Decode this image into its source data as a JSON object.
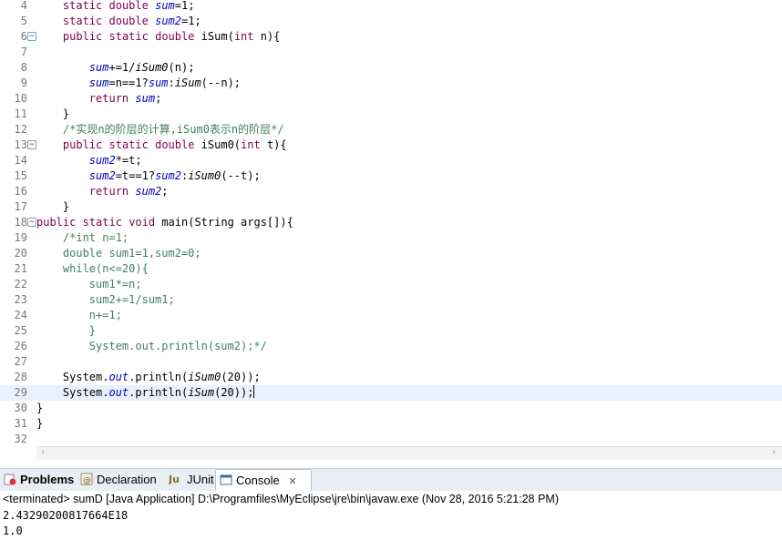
{
  "editor": {
    "lines": [
      {
        "n": "4",
        "segs": [
          [
            "p",
            "    "
          ],
          [
            "k",
            "static"
          ],
          [
            "p",
            " "
          ],
          [
            "k",
            "double"
          ],
          [
            "p",
            " "
          ],
          [
            "f",
            "sum"
          ],
          [
            "p",
            "=1;"
          ]
        ]
      },
      {
        "n": "5",
        "segs": [
          [
            "p",
            "    "
          ],
          [
            "k",
            "static"
          ],
          [
            "p",
            " "
          ],
          [
            "k",
            "double"
          ],
          [
            "p",
            " "
          ],
          [
            "f",
            "sum2"
          ],
          [
            "p",
            "=1;"
          ]
        ]
      },
      {
        "n": "6",
        "fold": "−",
        "segs": [
          [
            "p",
            "    "
          ],
          [
            "k",
            "public"
          ],
          [
            "p",
            " "
          ],
          [
            "k",
            "static"
          ],
          [
            "p",
            " "
          ],
          [
            "k",
            "double"
          ],
          [
            "p",
            " iSum("
          ],
          [
            "k",
            "int"
          ],
          [
            "p",
            " n){"
          ]
        ]
      },
      {
        "n": "7",
        "segs": []
      },
      {
        "n": "8",
        "segs": [
          [
            "p",
            "        "
          ],
          [
            "f",
            "sum"
          ],
          [
            "p",
            "+=1/"
          ],
          [
            "m",
            "iSum0"
          ],
          [
            "p",
            "(n);"
          ]
        ]
      },
      {
        "n": "9",
        "segs": [
          [
            "p",
            "        "
          ],
          [
            "f",
            "sum"
          ],
          [
            "p",
            "=n==1?"
          ],
          [
            "f",
            "sum"
          ],
          [
            "p",
            ":"
          ],
          [
            "m",
            "iSum"
          ],
          [
            "p",
            "(--n);"
          ]
        ]
      },
      {
        "n": "10",
        "segs": [
          [
            "p",
            "        "
          ],
          [
            "k",
            "return"
          ],
          [
            "p",
            " "
          ],
          [
            "f",
            "sum"
          ],
          [
            "p",
            ";"
          ]
        ]
      },
      {
        "n": "11",
        "segs": [
          [
            "p",
            "    }"
          ]
        ]
      },
      {
        "n": "12",
        "segs": [
          [
            "p",
            "    "
          ],
          [
            "c",
            "/*实现n的阶层的计算,iSum0表示n的阶层*/"
          ]
        ]
      },
      {
        "n": "13",
        "fold": "−",
        "segs": [
          [
            "p",
            "    "
          ],
          [
            "k",
            "public"
          ],
          [
            "p",
            " "
          ],
          [
            "k",
            "static"
          ],
          [
            "p",
            " "
          ],
          [
            "k",
            "double"
          ],
          [
            "p",
            " iSum0("
          ],
          [
            "k",
            "int"
          ],
          [
            "p",
            " t){"
          ]
        ]
      },
      {
        "n": "14",
        "segs": [
          [
            "p",
            "        "
          ],
          [
            "f",
            "sum2"
          ],
          [
            "p",
            "*=t;"
          ]
        ]
      },
      {
        "n": "15",
        "segs": [
          [
            "p",
            "        "
          ],
          [
            "f",
            "sum2"
          ],
          [
            "p",
            "=t==1?"
          ],
          [
            "f",
            "sum2"
          ],
          [
            "p",
            ":"
          ],
          [
            "m",
            "iSum0"
          ],
          [
            "p",
            "(--t);"
          ]
        ]
      },
      {
        "n": "16",
        "segs": [
          [
            "p",
            "        "
          ],
          [
            "k",
            "return"
          ],
          [
            "p",
            " "
          ],
          [
            "f",
            "sum2"
          ],
          [
            "p",
            ";"
          ]
        ]
      },
      {
        "n": "17",
        "segs": [
          [
            "p",
            "    }"
          ]
        ]
      },
      {
        "n": "18",
        "fold": "−",
        "segs": [
          [
            "k",
            "public"
          ],
          [
            "p",
            " "
          ],
          [
            "k",
            "static"
          ],
          [
            "p",
            " "
          ],
          [
            "k",
            "void"
          ],
          [
            "p",
            " main(String args[]){"
          ]
        ]
      },
      {
        "n": "19",
        "segs": [
          [
            "p",
            "    "
          ],
          [
            "c",
            "/*int n=1;"
          ]
        ]
      },
      {
        "n": "20",
        "segs": [
          [
            "p",
            "    "
          ],
          [
            "c",
            "double sum1=1,sum2=0;"
          ]
        ]
      },
      {
        "n": "21",
        "segs": [
          [
            "p",
            "    "
          ],
          [
            "c",
            "while(n<=20){"
          ]
        ]
      },
      {
        "n": "22",
        "segs": [
          [
            "p",
            "        "
          ],
          [
            "c",
            "sum1*=n;"
          ]
        ]
      },
      {
        "n": "23",
        "segs": [
          [
            "p",
            "        "
          ],
          [
            "c",
            "sum2+=1/sum1;"
          ]
        ]
      },
      {
        "n": "24",
        "segs": [
          [
            "p",
            "        "
          ],
          [
            "c",
            "n+=1;"
          ]
        ]
      },
      {
        "n": "25",
        "segs": [
          [
            "p",
            "        "
          ],
          [
            "c",
            "}"
          ]
        ]
      },
      {
        "n": "26",
        "segs": [
          [
            "p",
            "        "
          ],
          [
            "c",
            "System.out.println(sum2);*/"
          ]
        ]
      },
      {
        "n": "27",
        "segs": []
      },
      {
        "n": "28",
        "segs": [
          [
            "p",
            "    System."
          ],
          [
            "f",
            "out"
          ],
          [
            "p",
            ".println("
          ],
          [
            "m",
            "iSum0"
          ],
          [
            "p",
            "(20));"
          ]
        ]
      },
      {
        "n": "29",
        "current": true,
        "segs": [
          [
            "p",
            "    System."
          ],
          [
            "f",
            "out"
          ],
          [
            "p",
            ".println("
          ],
          [
            "m",
            "iSum"
          ],
          [
            "p",
            "(20));"
          ]
        ]
      },
      {
        "n": "30",
        "segs": [
          [
            "p",
            "}"
          ]
        ]
      },
      {
        "n": "31",
        "segs": [
          [
            "p",
            "}"
          ]
        ]
      },
      {
        "n": "32",
        "segs": []
      }
    ]
  },
  "tabs": {
    "problems": "Problems",
    "declaration": "Declaration",
    "junit": "JUnit",
    "console": "Console",
    "console_close": "✕"
  },
  "console": {
    "status": "<terminated> sumD [Java Application] D:\\Programfiles\\MyEclipse\\jre\\bin\\javaw.exe (Nov 28, 2016 5:21:28 PM)",
    "output": [
      "2.43290200817664E18",
      "1.0"
    ]
  },
  "colors": {
    "keyword": "#7f0055",
    "field": "#0000c0",
    "comment": "#3f7f5f",
    "current_line": "#e8f2fe"
  }
}
